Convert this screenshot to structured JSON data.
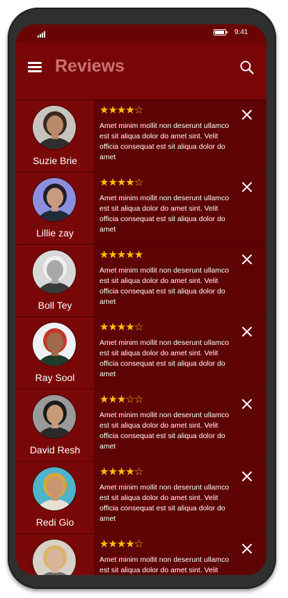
{
  "status_bar": {
    "time": "9:41"
  },
  "header": {
    "title": "Reviews",
    "menu_icon": "hamburger-icon",
    "search_icon": "search-icon"
  },
  "reviews": [
    {
      "name": "Suzie Brie",
      "rating": 4,
      "max_rating": 5,
      "text": "Amet minim mollit non deserunt ullamco est sit aliqua dolor do amet sint. Velit officia consequat est sit aliqua dolor do amet",
      "avatar_colors": {
        "bg": "#c9c3bd",
        "skin": "#b98b6b",
        "hair": "#3a2a20",
        "shirt": "#2e2e2e"
      }
    },
    {
      "name": "Lillie zay",
      "rating": 4,
      "max_rating": 5,
      "text": "Amet minim mollit non deserunt ullamco est sit aliqua dolor do amet sint. Velit officia consequat est sit aliqua dolor do amet",
      "avatar_colors": {
        "bg": "#8c8fe0",
        "skin": "#c79a80",
        "hair": "#1e1e2a",
        "shirt": "#1f2b3a"
      }
    },
    {
      "name": "Boll Tey",
      "rating": 5,
      "max_rating": 5,
      "text": "Amet minim mollit non deserunt ullamco est sit aliqua dolor do amet sint. Velit officia consequat est sit aliqua dolor do amet",
      "avatar_colors": {
        "bg": "#d8d8d8",
        "skin": "#a8a8a8",
        "hair": "#f0f0f0",
        "shirt": "#3a3a3a"
      }
    },
    {
      "name": "Ray Sool",
      "rating": 4,
      "max_rating": 5,
      "text": "Amet minim mollit non deserunt ullamco est sit aliqua dolor do amet sint. Velit officia consequat est sit aliqua dolor do amet",
      "avatar_colors": {
        "bg": "#eef1f4",
        "skin": "#a06a4c",
        "hair": "#c0392b",
        "shirt": "#1e3a2a"
      }
    },
    {
      "name": "David Resh",
      "rating": 3,
      "max_rating": 5,
      "text": "Amet minim mollit non deserunt ullamco est sit aliqua dolor do amet sint. Velit officia consequat est sit aliqua dolor do amet",
      "avatar_colors": {
        "bg": "#9a9a9a",
        "skin": "#c79a7a",
        "hair": "#1a1a1a",
        "shirt": "#2a2a2a"
      }
    },
    {
      "name": "Redi Gio",
      "rating": 4,
      "max_rating": 5,
      "text": "Amet minim mollit non deserunt ullamco est sit aliqua dolor do amet sint. Velit officia consequat est sit aliqua dolor do amet",
      "avatar_colors": {
        "bg": "#4fb3c9",
        "skin": "#c9956e",
        "hair": "#d9a441",
        "shirt": "#e8e0d4"
      }
    },
    {
      "name": "",
      "rating": 4,
      "max_rating": 5,
      "text": "Amet minim mollit non deserunt ullamco est sit aliqua dolor do amet sint. Velit officia consequat est sit aliqua dolor do amet",
      "avatar_colors": {
        "bg": "#d6d0c6",
        "skin": "#d9b49a",
        "hair": "#d8b46a",
        "shirt": "#6b6b6b"
      }
    }
  ],
  "colors": {
    "screen_bg": "#6a0404",
    "app_bar": "#780606",
    "title": "#c97373",
    "star": "#ffc107",
    "user_col": "#7a0707",
    "review_col": "#5e0303"
  }
}
